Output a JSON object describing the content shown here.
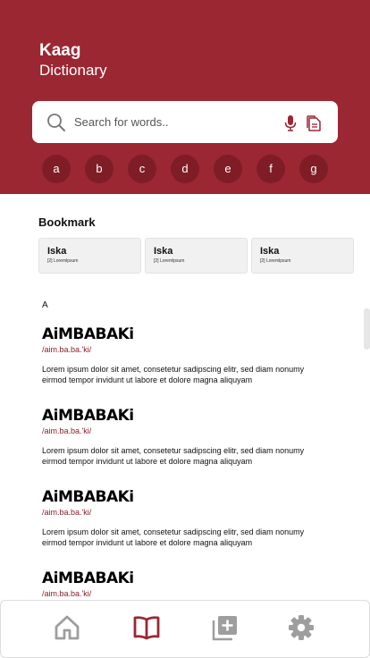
{
  "app": {
    "title_line1": "Kaag",
    "title_line2": "Dictionary"
  },
  "search": {
    "placeholder": "Search for words..",
    "value": ""
  },
  "letters": [
    "a",
    "b",
    "c",
    "d",
    "e",
    "f",
    "g"
  ],
  "bookmark": {
    "title": "Bookmark",
    "items": [
      {
        "word": "Iska",
        "definition": "[2] Loremlpsum"
      },
      {
        "word": "Iska",
        "definition": "[2] Loremlpsum"
      },
      {
        "word": "Iska",
        "definition": "[2] Loremlpsum"
      }
    ]
  },
  "section_letter": "A",
  "entries": [
    {
      "word": "AiMBABAKi",
      "pronunciation": "/aim.ba.ba.'ki/",
      "definition": "Lorem ipsum dolor sit amet, consetetur sadipscing elitr, sed diam nonumy eirmod tempor invidunt ut labore et dolore magna aliquyam"
    },
    {
      "word": "AiMBABAKi",
      "pronunciation": "/aim.ba.ba.'ki/",
      "definition": "Lorem ipsum dolor sit amet, consetetur sadipscing elitr, sed diam nonumy eirmod tempor invidunt ut labore et dolore magna aliquyam"
    },
    {
      "word": "AiMBABAKi",
      "pronunciation": "/aim.ba.ba.'ki/",
      "definition": "Lorem ipsum dolor sit amet, consetetur sadipscing elitr, sed diam nonumy eirmod tempor invidunt ut labore et dolore magna aliquyam"
    },
    {
      "word": "AiMBABAKi",
      "pronunciation": "/aim.ba.ba.'ki/",
      "definition": ""
    }
  ],
  "nav": {
    "items": [
      {
        "icon": "home-icon",
        "active": false
      },
      {
        "icon": "book-icon",
        "active": true
      },
      {
        "icon": "add-library-icon",
        "active": false
      },
      {
        "icon": "gear-icon",
        "active": false
      }
    ]
  },
  "colors": {
    "brand": "#9b2733",
    "brand_dark": "#7f1d27",
    "inactive_icon": "#9e9e9e"
  }
}
